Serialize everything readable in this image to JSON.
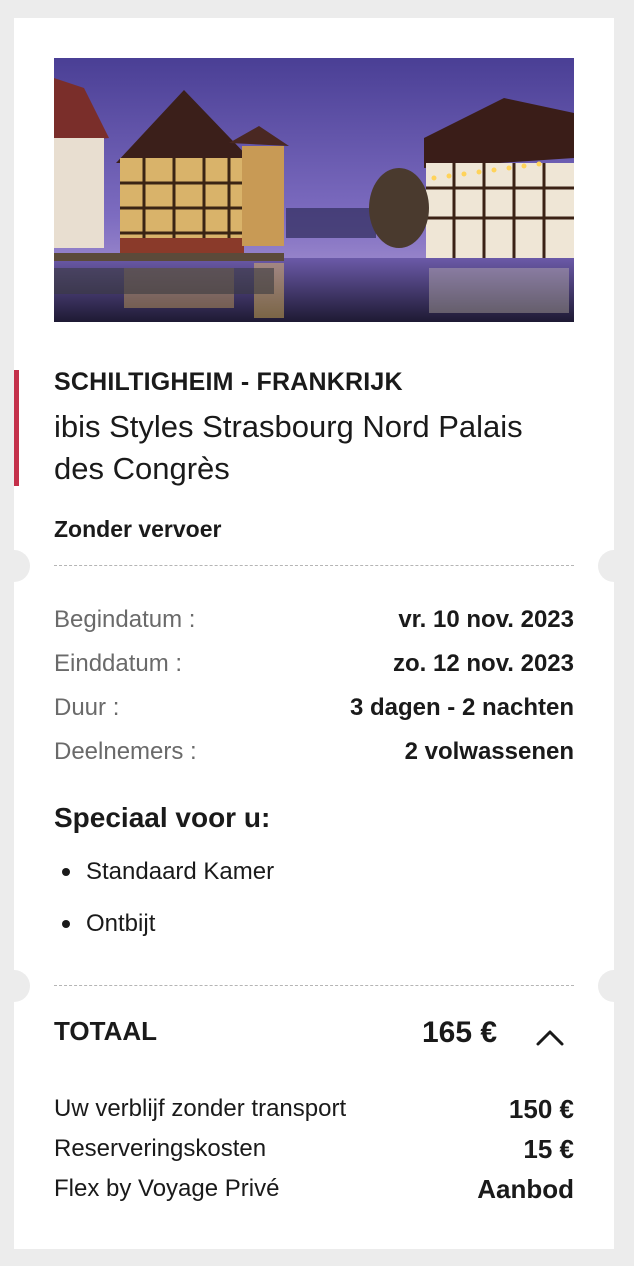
{
  "summary": {
    "location": "SCHILTIGHEIM - FRANKRIJK",
    "hotel_name": "ibis Styles Strasbourg Nord Palais des Congrès",
    "transport": "Zonder vervoer"
  },
  "details": [
    {
      "label": "Begindatum :",
      "value": "vr. 10 nov. 2023"
    },
    {
      "label": "Einddatum :",
      "value": "zo. 12 nov. 2023"
    },
    {
      "label": "Duur :",
      "value": "3 dagen - 2 nachten"
    },
    {
      "label": "Deelnemers :",
      "value": "2 volwassenen"
    }
  ],
  "special": {
    "title": "Speciaal voor u:",
    "items": [
      "Standaard Kamer",
      "Ontbijt"
    ]
  },
  "total": {
    "label": "TOTAAL",
    "value": "165 €",
    "toggle_icon": "chevron-up-icon"
  },
  "breakdown": [
    {
      "label": "Uw verblijf zonder transport",
      "value": "150 €"
    },
    {
      "label": "Reserveringskosten",
      "value": "15 €"
    },
    {
      "label": "Flex by Voyage Privé",
      "value": "Aanbod"
    }
  ],
  "colors": {
    "accent": "#c4304a",
    "page_background": "#ececec",
    "card_background": "#ffffff"
  }
}
